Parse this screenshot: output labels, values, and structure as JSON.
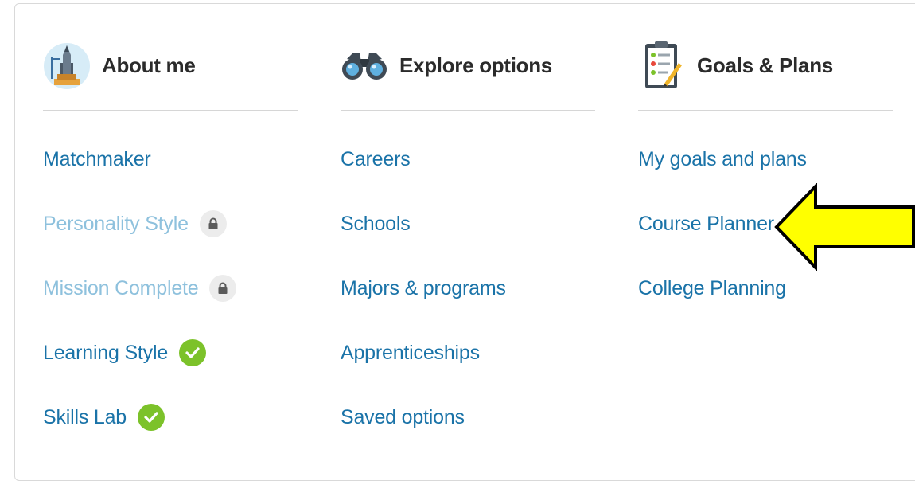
{
  "columns": [
    {
      "id": "about-me",
      "title": "About me",
      "icon": "rocket-launch-icon",
      "links": [
        {
          "label": "Matchmaker",
          "status": "normal"
        },
        {
          "label": "Personality Style",
          "status": "locked",
          "badge_icon": "lock-icon"
        },
        {
          "label": "Mission Complete",
          "status": "locked",
          "badge_icon": "lock-icon"
        },
        {
          "label": "Learning Style",
          "status": "complete",
          "badge_icon": "check-icon"
        },
        {
          "label": "Skills Lab",
          "status": "complete",
          "badge_icon": "check-icon"
        }
      ]
    },
    {
      "id": "explore-options",
      "title": "Explore options",
      "icon": "binoculars-icon",
      "links": [
        {
          "label": "Careers",
          "status": "normal"
        },
        {
          "label": "Schools",
          "status": "normal"
        },
        {
          "label": "Majors & programs",
          "status": "normal"
        },
        {
          "label": "Apprenticeships",
          "status": "normal"
        },
        {
          "label": "Saved options",
          "status": "normal"
        }
      ]
    },
    {
      "id": "goals-plans",
      "title": "Goals & Plans",
      "icon": "clipboard-checklist-icon",
      "links": [
        {
          "label": "My goals and plans",
          "status": "normal"
        },
        {
          "label": "Course Planner",
          "status": "normal"
        },
        {
          "label": "College Planning",
          "status": "normal"
        }
      ]
    }
  ],
  "annotation": {
    "icon": "yellow-arrow-icon",
    "target": "Course Planner"
  },
  "colors": {
    "link": "#1a73a8",
    "link_locked": "#8ec1dd",
    "check_badge": "#7cc22a",
    "lock_badge": "#ececec",
    "arrow_fill": "#ffff00",
    "title": "#2b2b2b"
  }
}
